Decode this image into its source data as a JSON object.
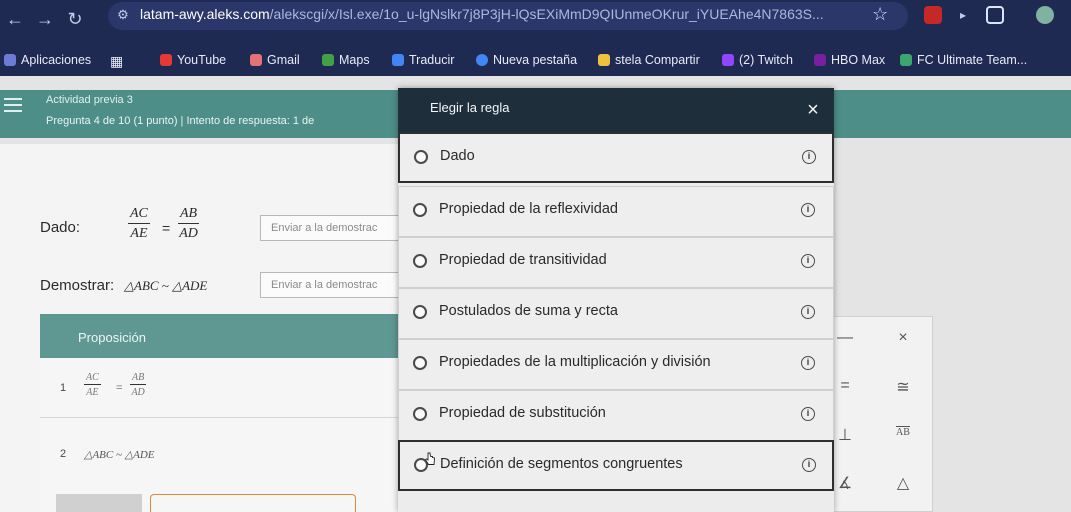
{
  "browser": {
    "url_domain": "latam-awy.aleks.com",
    "url_path": "/alekscgi/x/Isl.exe/1o_u-lgNslkr7j8P3jH-lQsEXiMmD9QIUnmeOKrur_iYUEAhe4N7863S...",
    "bookmarks": [
      "Aplicaciones",
      "YouTube",
      "Gmail",
      "Maps",
      "Traducir",
      "Nueva pestaña",
      "stela Compartir",
      "(2) Twitch",
      "HBO Max",
      "FC Ultimate Team..."
    ],
    "bookmark_colors": [
      "#6b7bd6",
      "#e53935",
      "#e57373",
      "#43a047",
      "#4285f4",
      "#4285f4",
      "#f0c040",
      "#9146ff",
      "#7a1fa2",
      "#3aa76d"
    ]
  },
  "header": {
    "activity": "Actividad previa 3",
    "question_info": "Pregunta 4 de 10 (1 punto)  |  Intento de respuesta: 1 de"
  },
  "problem": {
    "given_label": "Dado:",
    "given_frac1": {
      "num": "AC",
      "den": "AE"
    },
    "given_frac2": {
      "num": "AB",
      "den": "AD"
    },
    "equals": "=",
    "submit_placeholder": "Enviar a la demostrac",
    "prove_label": "Demostrar:",
    "prove_statement": "△ABC ~ △ADE",
    "submit_placeholder2": "Enviar a la demostrac"
  },
  "table": {
    "header": "Proposición",
    "rows": [
      {
        "num": "1",
        "statement_num1": "AC",
        "statement_den1": "AE",
        "statement_num2": "AB",
        "statement_den2": "AD"
      },
      {
        "num": "2",
        "statement": "△ABC ~ △ADE"
      }
    ]
  },
  "modal": {
    "title": "Elegir la regla",
    "close": "×",
    "options": [
      "Dado",
      "Propiedad de la reflexividad",
      "Propiedad de transitividad",
      "Postulados de suma y recta",
      "Propiedades de la multiplicación y división",
      "Propiedad de substitución",
      "Definición de segmentos congruentes"
    ],
    "info_glyph": "i"
  },
  "tools": {
    "minus": "—",
    "close": "×",
    "equals": "=",
    "congruent": "≅",
    "perp": "⊥",
    "segment": "AB",
    "angle1": "∠",
    "angle2": "∡",
    "triangle": "△"
  }
}
